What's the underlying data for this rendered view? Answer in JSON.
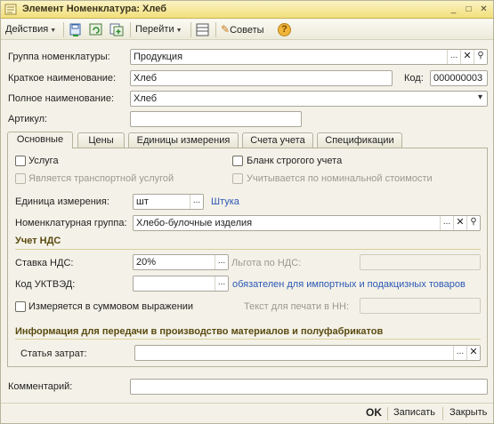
{
  "window": {
    "title": "Элемент Номенклатура: Хлеб"
  },
  "toolbar": {
    "actions_label": "Действия",
    "goto_label": "Перейти",
    "tips_label": "Советы",
    "help_glyph": "?"
  },
  "header": {
    "group_label": "Группа номенклатуры:",
    "group_value": "Продукция",
    "short_name_label": "Краткое наименование:",
    "short_name_value": "Хлеб",
    "code_label": "Код:",
    "code_value": "000000003",
    "full_name_label": "Полное наименование:",
    "full_name_value": "Хлеб",
    "article_label": "Артикул:",
    "article_value": ""
  },
  "tabs": [
    {
      "label": "Основные",
      "active": true
    },
    {
      "label": "Цены"
    },
    {
      "label": "Единицы измерения"
    },
    {
      "label": "Счета учета"
    },
    {
      "label": "Спецификации"
    }
  ],
  "main": {
    "service_label": "Услуга",
    "transport_label": "Является транспортной услугой",
    "strict_form_label": "Бланк строгого учета",
    "nominal_label": "Учитывается по номинальной стоимости",
    "unit_label": "Единица измерения:",
    "unit_value": "шт",
    "unit_link": "Штука",
    "nom_group_label": "Номенклатурная группа:",
    "nom_group_value": "Хлебо-булочные изделия",
    "vat_section": "Учет НДС",
    "vat_rate_label": "Ставка НДС:",
    "vat_rate_value": "20%",
    "vat_benefit_label": "Льгота по НДС:",
    "vat_benefit_value": "",
    "ukt_label": "Код УКТВЭД:",
    "ukt_value": "",
    "ukt_link": "обязателен для импортных и подакцизных товаров",
    "sum_expr_label": "Измеряется в суммовом выражении",
    "print_text_label": "Текст для печати в НН:",
    "print_text_value": "",
    "production_section": "Информация для передачи в производство материалов и полуфабрикатов",
    "cost_item_label": "Статья затрат:",
    "cost_item_value": ""
  },
  "footer": {
    "comment_label": "Комментарий:",
    "comment_value": "",
    "ok_label": "OK",
    "save_label": "Записать",
    "close_label": "Закрыть"
  },
  "glyphs": {
    "ellipsis": "...",
    "clear": "✕",
    "search": "⚲",
    "dropdown": "▾"
  },
  "colors": {
    "title_bar": "#f2df7b",
    "link": "#2b57b5",
    "section_header": "#5a4a10",
    "background": "#f4f2e8"
  }
}
